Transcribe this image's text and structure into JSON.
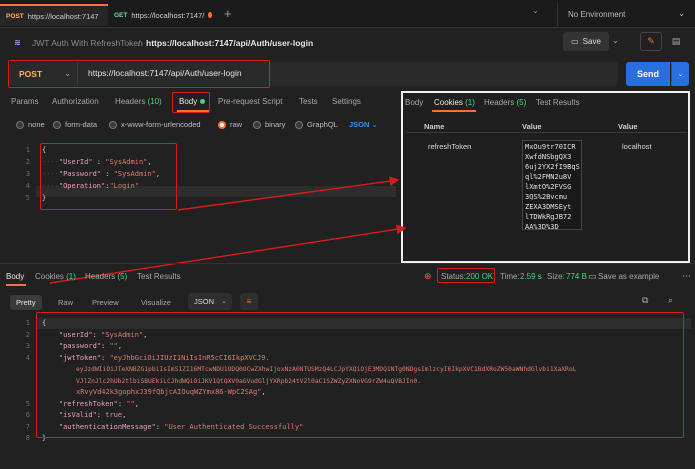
{
  "tabs": [
    {
      "method": "POST",
      "title": "https://localhost:7147",
      "active": true
    },
    {
      "method": "GET",
      "title": "https://localhost:7147/",
      "active": false
    }
  ],
  "environment": "No Environment",
  "breadcrumb": {
    "parent": "JWT Auth With RefreshToken",
    "separator": "/",
    "current": "https://localhost:7147/api/Auth/user-login"
  },
  "toolbar": {
    "save_label": "Save"
  },
  "request": {
    "method": "POST",
    "url": "https://localhost:7147/api/Auth/user-login",
    "send_label": "Send",
    "tabs": [
      {
        "label": "Params"
      },
      {
        "label": "Authorization"
      },
      {
        "label": "Headers",
        "count": "(10)"
      },
      {
        "label": "Body"
      },
      {
        "label": "Pre-request Script"
      },
      {
        "label": "Tests"
      },
      {
        "label": "Settings"
      }
    ],
    "body_modes": [
      "none",
      "form-data",
      "x-www-form-urlencoded",
      "raw",
      "binary",
      "GraphQL"
    ],
    "body_format": "JSON",
    "body_lines": [
      {
        "n": "1",
        "open": "{"
      },
      {
        "n": "2",
        "key": "\"UserId\"",
        "value": "\"SysAdmin\"",
        "tail": ","
      },
      {
        "n": "3",
        "key": "\"Password\"",
        "value": "\"SysAdmin\"",
        "tail": ","
      },
      {
        "n": "4",
        "key": "\"Operation\"",
        "value": "\"Login\"",
        "tail": ""
      },
      {
        "n": "5",
        "close": "}"
      }
    ]
  },
  "cookie_panel": {
    "tabs": [
      {
        "label": "Body"
      },
      {
        "label": "Cookies",
        "count": "(1)"
      },
      {
        "label": "Headers",
        "count": "(5)"
      },
      {
        "label": "Test Results"
      }
    ],
    "columns": [
      "Name",
      "Value",
      "Value"
    ],
    "cookie": {
      "name": "refreshToken",
      "value": "MxOu9tr70ICR\nXwfdNSbgQX3\n6uj2YX2fI9BqS\nql%2FMN2u8V\nlXmtO%2FVSG\n3QS%2Bvcmu\nZEXA3DMSEyt\nlTDWkRgJB72\nAA%3D%3D",
      "domain": "localhost"
    }
  },
  "response": {
    "tabs": [
      {
        "label": "Body"
      },
      {
        "label": "Cookies",
        "count": "(1)"
      },
      {
        "label": "Headers",
        "count": "(5)"
      },
      {
        "label": "Test Results"
      }
    ],
    "status_label": "Status:",
    "status_value": "200 OK",
    "time_label": "Time:",
    "time_value": "2.59 s",
    "size_label": "Size:",
    "size_value": "774 B",
    "save_example": "Save as example",
    "format_tabs": [
      "Pretty",
      "Raw",
      "Preview",
      "Visualize"
    ],
    "format": "JSON",
    "line_numbers": [
      "1",
      "2",
      "3",
      "4",
      "",
      "",
      "",
      "5",
      "6",
      "7",
      "8"
    ],
    "lines": {
      "open": "{",
      "userId_key": "\"userId\"",
      "userId_val": "\"SysAdmin\"",
      "password_key": "\"password\"",
      "password_val": "\"\"",
      "jwt_key": "\"jwtToken\"",
      "jwt_1": "\"eyJhbGciOiJIUzI1NiIsInR5cCI6IkpXVCJ9.",
      "jwt_2": "eyJzdWIiOiJTeXNBZG1pbiIsImS1ZI16MTcwNDU1ODQ0OCwZXhwIjoxNzA0NTUSMzQ4LCJpYXQiOjE3MDQ1NTg0NDgsImlzcyI6IkpXVC1BdXRoZW50aWNhdGlvbi1XaXRoL",
      "jwt_3": "VJlZnJlc2hUb2tlbiSBUEkiLCJhdWQiOiJKV1QtQXV0aGVudGljYXRpb24tV2l0aC1SZWZyZXNoVG9rZW4uQVBJIn0.",
      "jwt_4": "xRvyVd42k3gophxJ39fQbjcAIOuqWZYmx86-WpC2SAg\"",
      "refresh_key": "\"refreshToken\"",
      "refresh_val": "\"\"",
      "valid_key": "\"isValid\"",
      "valid_val": "true",
      "msg_key": "\"authenticationMessage\"",
      "msg_val": "\"User Authenticated Successfully\"",
      "close": "}"
    }
  }
}
